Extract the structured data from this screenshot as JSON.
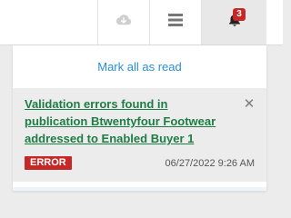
{
  "header": {
    "icons": {
      "cloud": "cloud-download-icon",
      "list": "list-view-icon",
      "bell": "bell-icon"
    },
    "notifications_count": "3"
  },
  "notifications_panel": {
    "mark_all_label": "Mark all as read",
    "items": [
      {
        "title": "Validation errors found in publication Btwentyfour Footwear addressed to Enabled Buyer 1",
        "status": "ERROR",
        "timestamp": "06/27/2022 9:26 AM"
      }
    ]
  },
  "colors": {
    "accent": "#2a8fd1",
    "link_green": "#1e7d45",
    "error_red": "#c62828",
    "panel_bg": "#ececec"
  }
}
